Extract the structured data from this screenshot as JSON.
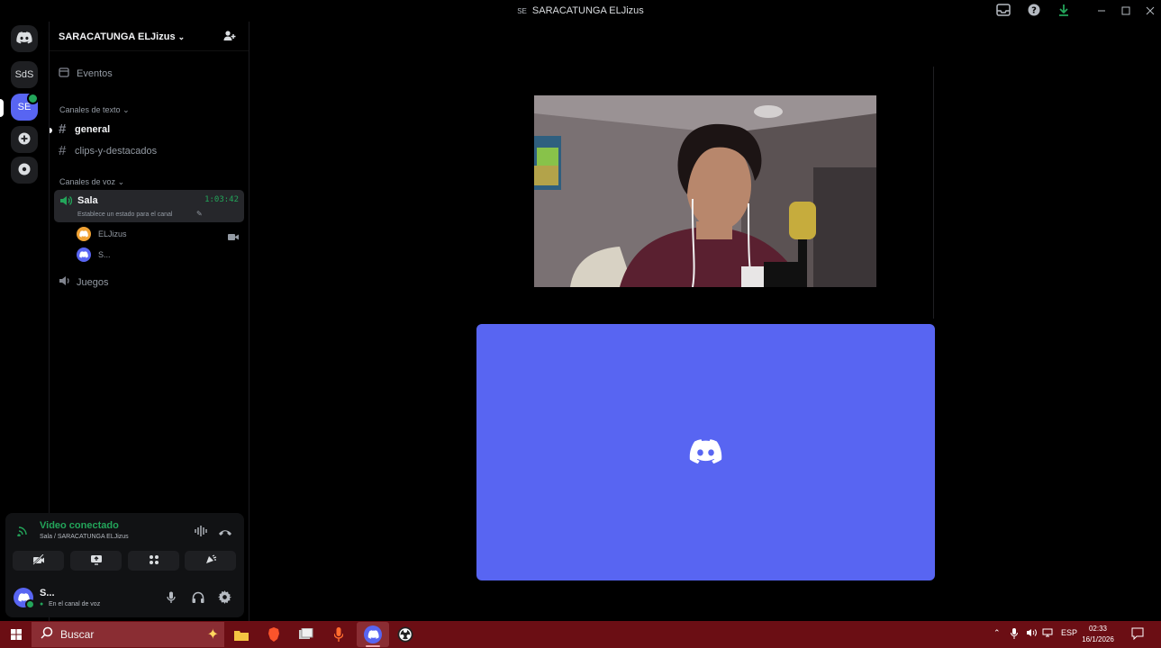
{
  "window": {
    "title": "SARACATUNGA ELJizus",
    "title_abbrev": "SE"
  },
  "servers": [
    {
      "label": ""
    },
    {
      "label": "SdS"
    },
    {
      "label": "SE"
    }
  ],
  "guild": {
    "name": "SARACATUNGA ELJizus"
  },
  "events": {
    "label": "Eventos"
  },
  "text_category": {
    "label": "Canales de texto"
  },
  "text_channels": [
    {
      "name": "general"
    },
    {
      "name": "clips-y-destacados"
    }
  ],
  "voice_category": {
    "label": "Canales de voz"
  },
  "voice_channels": [
    {
      "name": "Sala",
      "timer": "1:03:42",
      "status_placeholder": "Establece un estado para el canal",
      "members": [
        {
          "name": "ELJizus",
          "avatar_color": "#f0a234"
        },
        {
          "name": "S...",
          "avatar_color": "#5865f2"
        }
      ]
    },
    {
      "name": "Juegos"
    }
  ],
  "voice_panel": {
    "status": "Video conectado",
    "location": "Sala / SARACATUNGA ELJizus",
    "status_color": "#23a55a"
  },
  "user_panel": {
    "name": "S...",
    "status": "En el canal de voz"
  },
  "taskbar": {
    "search_placeholder": "Buscar",
    "language": "ESP",
    "time": "02:33",
    "date": "16/1/2026"
  },
  "colors": {
    "accent": "#5865f2",
    "green": "#23a55a",
    "taskbar": "#6b0e14"
  }
}
